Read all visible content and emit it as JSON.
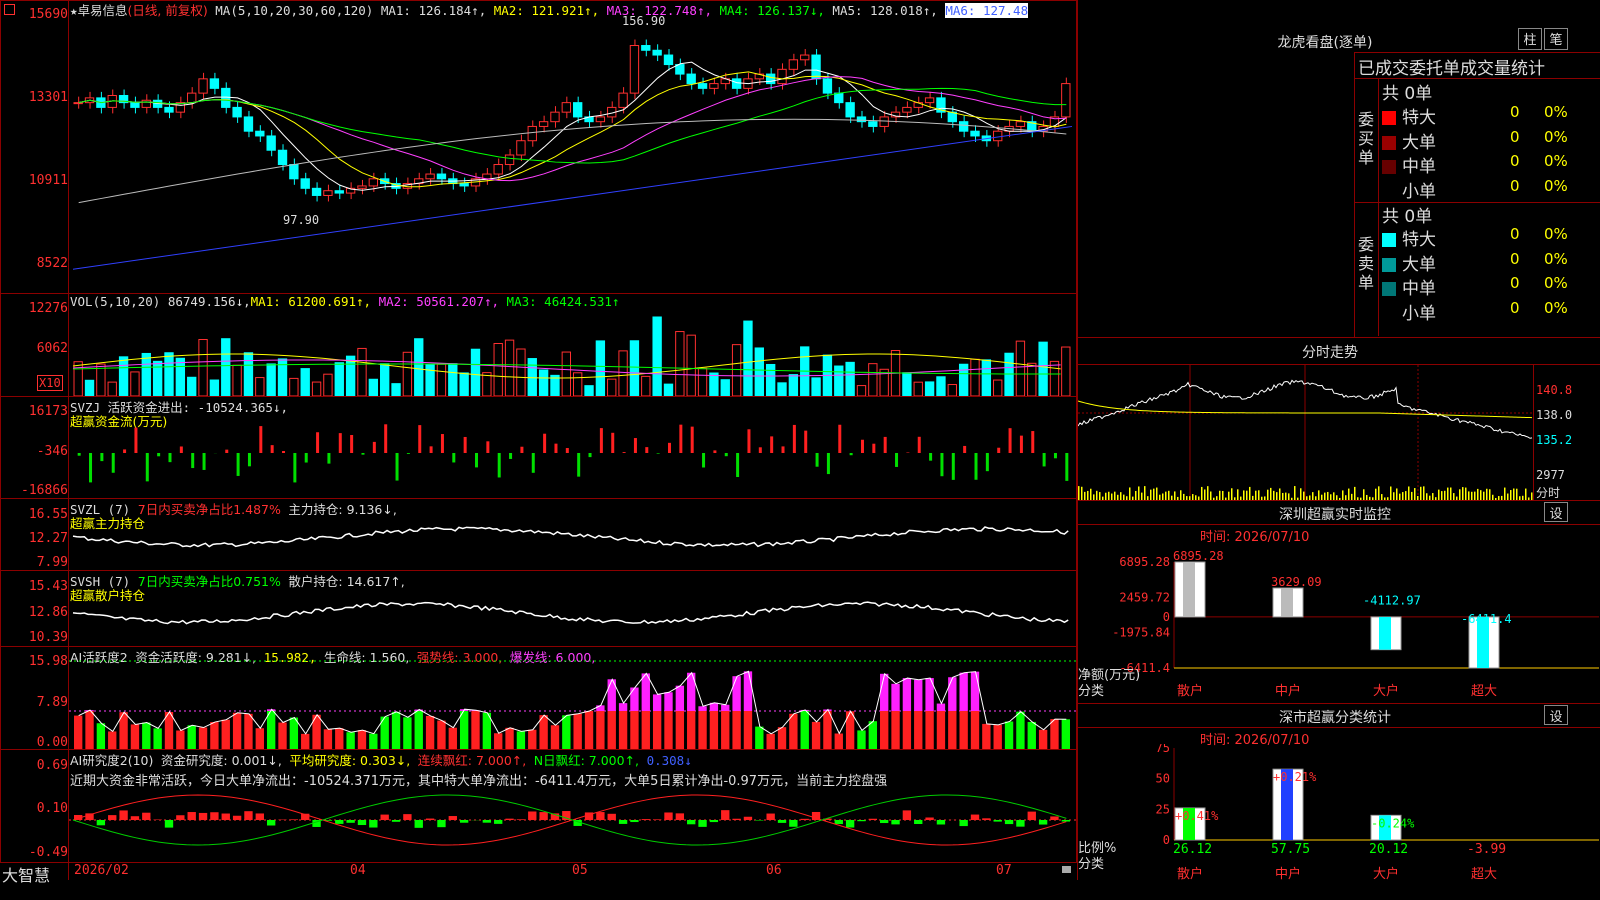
{
  "stock": {
    "star_icon": "★",
    "name": "卓易信息",
    "mode": "(日线, 前复权)",
    "ma_label": "MA(5,10,20,30,60,120)",
    "ma1": "MA1: 126.184↑,",
    "ma2": "MA2: 121.921↑,",
    "ma3": "MA3: 122.748↑,",
    "ma4": "MA4: 126.137↓,",
    "ma5": "MA5: 128.018↑,",
    "ma6": "MA6: 127.48",
    "high_mark": "156.90",
    "low_mark": "97.90",
    "axis": [
      "15690",
      "13301",
      "10911",
      "8522"
    ]
  },
  "vol": {
    "label": "VOL(5,10,20)",
    "val": "86749.156↓,",
    "ma1": "MA1: 61200.691↑,",
    "ma2": "MA2: 50561.207↑,",
    "ma3": "MA3: 46424.531↑",
    "axis": [
      "12276",
      "6062"
    ],
    "unit": "X10"
  },
  "svzj": {
    "label": "SVZJ  活跃资金进出: -10524.365↓,",
    "sub": "超赢资金流(万元)",
    "axis": [
      "16173",
      "-346",
      "-16866"
    ]
  },
  "svzl": {
    "label": "SVZL (7)",
    "ratio": "7日内买卖净占比1.487%",
    "hold": "主力持仓: 9.136↓,",
    "sub": "超赢主力持仓",
    "axis": [
      "16.55",
      "12.27",
      "7.99"
    ]
  },
  "svsh": {
    "label": "SVSH (7)",
    "ratio": "7日内买卖净占比0.751%",
    "hold": "散户持仓: 14.617↑,",
    "sub": "超赢散户持仓",
    "axis": [
      "15.43",
      "12.86",
      "10.39"
    ]
  },
  "ai1": {
    "label": "AI活跃度2",
    "a": "资金活跃度: 9.281↓,",
    "b": "15.982,",
    "c": "生命线: 1.560,",
    "d": "强势线: 3.000,",
    "e": "爆发线: 6.000,",
    "axis": [
      "15.98",
      "7.89",
      "0.00"
    ]
  },
  "ai2": {
    "label": "AI研究度2(10)",
    "a": "资金研究度: 0.001↓,",
    "b": "平均研究度: 0.303↓,",
    "c": "连续飘红: 7.000↑,",
    "d": "N日飘红: 7.000↑,",
    "e": "0.308↓",
    "summary": "近期大资金非常活跃，今日大单净流出：-10524.371万元，其中特大单净流出：-6411.4万元，大单5日累计净出-0.97万元，当前主力控盘强",
    "axis": [
      "0.69",
      "0.10",
      "-0.49"
    ]
  },
  "dates": [
    "2026/02",
    "04",
    "05",
    "06",
    "07"
  ],
  "brand": "大智慧",
  "right": {
    "dragon_title": "龙虎看盘(逐单)",
    "btn_bar": "柱",
    "btn_pen": "笔",
    "tabs": "已成交委托单成交量统计",
    "buy_side": "委买单",
    "sell_side": "委卖单",
    "buy_total": "共 0单",
    "sell_total": "共 0单",
    "buy_rows": [
      {
        "label": "特大",
        "val": "0",
        "pct": "0%",
        "color": "#ff0000"
      },
      {
        "label": "大单",
        "val": "0",
        "pct": "0%",
        "color": "#990000"
      },
      {
        "label": "中单",
        "val": "0",
        "pct": "0%",
        "color": "#660000"
      },
      {
        "label": "小单",
        "val": "0",
        "pct": "0%",
        "color": ""
      }
    ],
    "sell_rows": [
      {
        "label": "特大",
        "val": "0",
        "pct": "0%",
        "color": "#00ffff"
      },
      {
        "label": "大单",
        "val": "0",
        "pct": "0%",
        "color": "#009999"
      },
      {
        "label": "中单",
        "val": "0",
        "pct": "0%",
        "color": "#007777"
      },
      {
        "label": "小单",
        "val": "0",
        "pct": "0%",
        "color": ""
      }
    ],
    "intraday_title": "分时走势",
    "intraday_axis": [
      "140.8",
      "138.0",
      "135.2",
      "2977",
      "分时"
    ],
    "monitor_title": "深圳超赢实时监控",
    "set_label": "设",
    "monitor_time": "时间: 2026/07/10",
    "monitor_axis": [
      "6895.28",
      "2459.72",
      "0",
      "-1975.84",
      "-6411.4"
    ],
    "monitor_ylabel": "净额(万元)",
    "monitor_xlabel": "分类",
    "monitor_cats": [
      "散户",
      "中户",
      "大户",
      "超大"
    ],
    "monitor_vals": [
      "6895.28",
      "3629.09",
      "-4112.97",
      "-6411.4"
    ],
    "class_title": "深市超赢分类统计",
    "class_time": "时间: 2026/07/10",
    "class_axis": [
      "75",
      "50",
      "25",
      "0"
    ],
    "class_ylabel": "比例%",
    "class_xlabel": "分类",
    "class_top": [
      "+0.41%",
      "+0.21%",
      "-0.24%",
      ""
    ],
    "class_vals": [
      "26.12",
      "57.75",
      "20.12",
      "-3.99"
    ]
  },
  "chart_data": [
    {
      "type": "bar",
      "title": "深圳超赢实时监控",
      "xlabel": "分类",
      "ylabel": "净额(万元)",
      "categories": [
        "散户",
        "中户",
        "大户",
        "超大"
      ],
      "values": [
        6895.28,
        3629.09,
        -4112.97,
        -6411.4
      ],
      "ylim": [
        -6411.4,
        6895.28
      ]
    },
    {
      "type": "bar",
      "title": "深市超赢分类统计",
      "xlabel": "分类",
      "ylabel": "比例%",
      "categories": [
        "散户",
        "中户",
        "大户",
        "超大"
      ],
      "values": [
        26.12,
        57.75,
        20.12,
        -3.99
      ],
      "ylim": [
        0,
        75
      ]
    }
  ]
}
